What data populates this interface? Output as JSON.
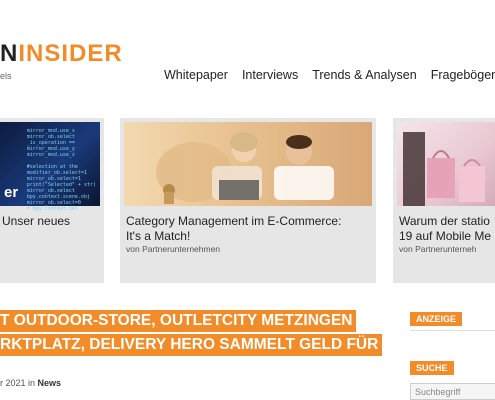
{
  "logo": {
    "prefix": "N",
    "name": "INSIDER",
    "sub": "els"
  },
  "nav": [
    "Whitepaper",
    "Interviews",
    "Trends & Analysen",
    "Fragebögen"
  ],
  "cards": [
    {
      "title": "Unser neues",
      "source": "",
      "img_text": "er",
      "code": "mirror_mod.use_x\nmirror_ob.select\n_is_operation ==\nmirror_mod.use_y\nmirror_mod.use_z\n\n#selection at the\nmodifier_ob.select=1\nmirror_ob.select=1\nprint(\"Selected\" + str(\nmirror_ob.select\nbpy.context.scene.obj\nmirror_ob.select=0\n= bpy.context.sel"
    },
    {
      "title": "Category Management im E-Commerce:",
      "title2": "It's a Match!",
      "source": "von Partnerunternehmen"
    },
    {
      "title": "Warum der statio",
      "title2": "19 auf Mobile Me",
      "source": "von Partnerunterneh"
    }
  ],
  "headline": {
    "line1": "T OUTDOOR-STORE, OUTLETCITY METZINGEN",
    "line2": "RKTPLATZ, DELIVERY HERO SAMMELT GELD FÜR",
    "line3": ""
  },
  "meta": {
    "date": "r 2021 in ",
    "category": "News"
  },
  "sidebar": {
    "ad_label": "ANZEIGE",
    "search_label": "SUCHE",
    "search_placeholder": "Suchbegriff"
  },
  "colors": {
    "accent": "#f28c28",
    "card_bg": "#e6e6e6"
  }
}
